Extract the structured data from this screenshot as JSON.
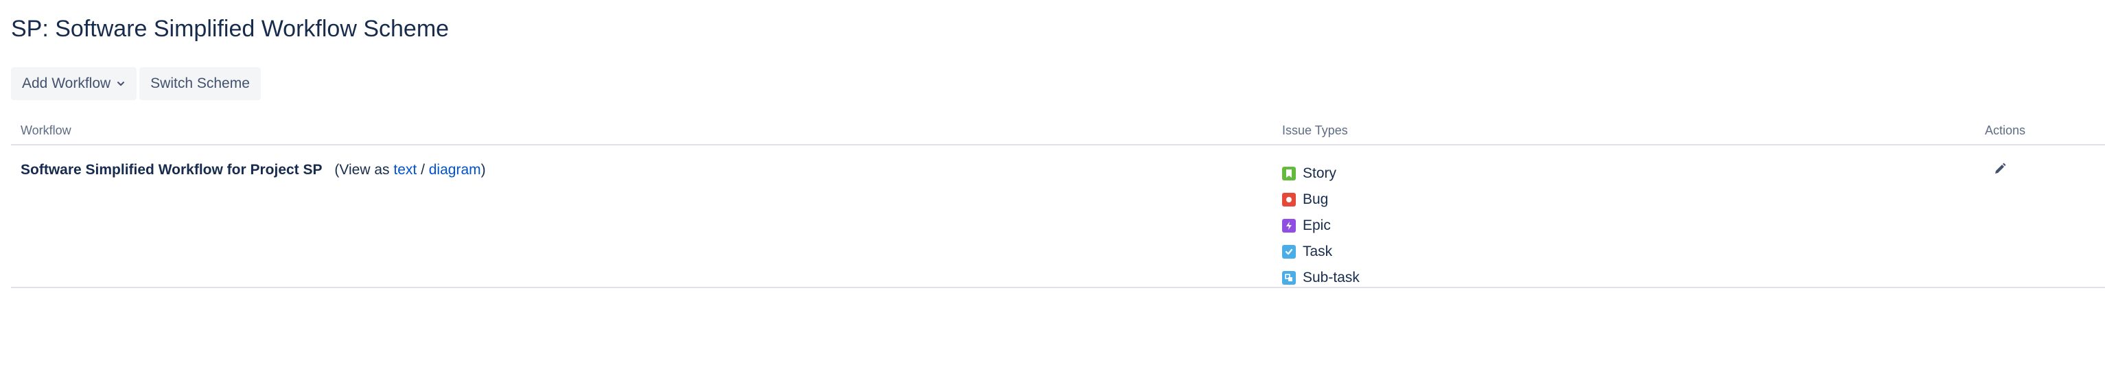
{
  "page": {
    "title": "SP: Software Simplified Workflow Scheme"
  },
  "toolbar": {
    "add_workflow_label": "Add Workflow",
    "switch_scheme_label": "Switch Scheme"
  },
  "table": {
    "headers": {
      "workflow": "Workflow",
      "issue_types": "Issue Types",
      "actions": "Actions"
    },
    "rows": [
      {
        "workflow_name": "Software Simplified Workflow for Project SP",
        "view_prefix": "(View as",
        "view_text_link": "text",
        "view_separator": "/",
        "view_diagram_link": "diagram",
        "view_suffix": ")",
        "issue_types": [
          {
            "label": "Story",
            "icon": "story-icon",
            "color": "#63ba3c"
          },
          {
            "label": "Bug",
            "icon": "bug-icon",
            "color": "#e5493a"
          },
          {
            "label": "Epic",
            "icon": "epic-icon",
            "color": "#904ee2"
          },
          {
            "label": "Task",
            "icon": "task-icon",
            "color": "#4bade8"
          },
          {
            "label": "Sub-task",
            "icon": "subtask-icon",
            "color": "#4bade8"
          }
        ],
        "action_icon": "edit-icon"
      }
    ]
  },
  "colors": {
    "text_primary": "#172b4d",
    "text_secondary": "#5e6c84",
    "link": "#0052cc",
    "button_bg": "#f4f5f7",
    "divider": "#dfe1e6"
  }
}
